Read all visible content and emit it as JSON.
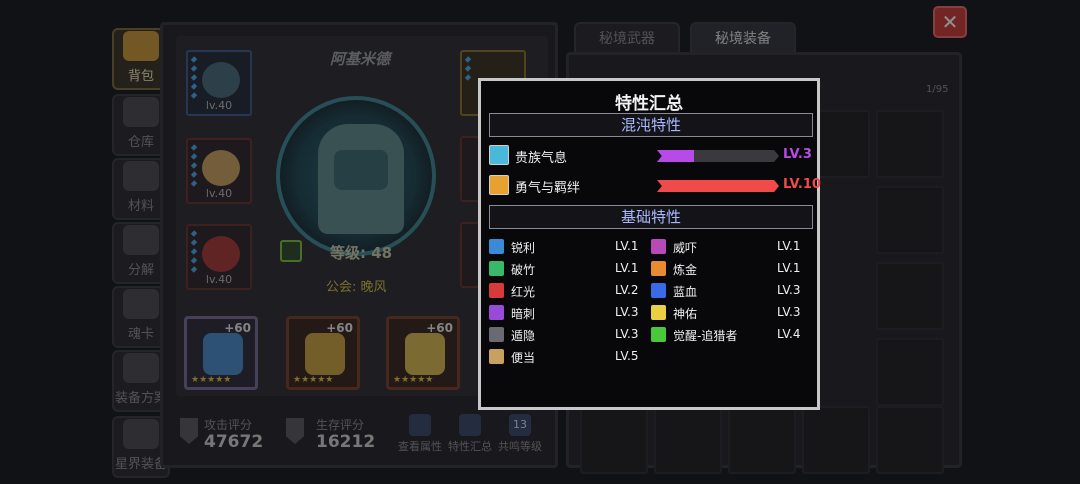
{
  "side_tabs": [
    {
      "label": "背包",
      "active": true
    },
    {
      "label": "仓库",
      "active": false
    },
    {
      "label": "材料",
      "active": false
    },
    {
      "label": "分解",
      "active": false
    },
    {
      "label": "魂卡",
      "active": false
    },
    {
      "label": "装备方案",
      "active": false
    },
    {
      "label": "星界装备",
      "active": false
    }
  ],
  "character": {
    "name": "阿基米德",
    "level_label": "等级: 48",
    "guild_label": "公会: 晚风",
    "equip_levels": [
      "lv.40",
      "lv.40",
      "lv.40",
      "lv.40"
    ],
    "upgrade_plus": [
      "+60",
      "+60",
      "+60"
    ],
    "stars": "★★★★★"
  },
  "stats": {
    "attack_label": "攻击评分",
    "attack_value": "47672",
    "survival_label": "生存评分",
    "survival_value": "16212"
  },
  "bottom_buttons": [
    {
      "label": "查看属性"
    },
    {
      "label": "特性汇总"
    },
    {
      "label": "共鸣等级",
      "badge": "13"
    }
  ],
  "right_tabs": [
    {
      "label": "秘境武器",
      "active": false
    },
    {
      "label": "秘境装备",
      "active": true
    }
  ],
  "inventory_count": "1/95",
  "close_label": "✕",
  "popup": {
    "title": "特性汇总",
    "chaos_header": "混沌特性",
    "chaos_traits": [
      {
        "name": "贵族气息",
        "level": "LV.3",
        "color": "#b84ae8",
        "fill": 0.3,
        "icon_color": "#4ab8d8"
      },
      {
        "name": "勇气与羁绊",
        "level": "LV.10",
        "color": "#f04a4a",
        "fill": 1.0,
        "icon_color": "#e8a030"
      }
    ],
    "basic_header": "基础特性",
    "basic_left": [
      {
        "name": "锐利",
        "level": "LV.1",
        "icon_color": "#3a8ad8"
      },
      {
        "name": "破竹",
        "level": "LV.1",
        "icon_color": "#3ab86a"
      },
      {
        "name": "红光",
        "level": "LV.2",
        "icon_color": "#d83a3a"
      },
      {
        "name": "暗刺",
        "level": "LV.3",
        "icon_color": "#9a4ad8"
      },
      {
        "name": "遁隐",
        "level": "LV.3",
        "icon_color": "#6a6a72"
      },
      {
        "name": "便当",
        "level": "LV.5",
        "icon_color": "#c8a060"
      }
    ],
    "basic_right": [
      {
        "name": "威吓",
        "level": "LV.1",
        "icon_color": "#b84ab8"
      },
      {
        "name": "炼金",
        "level": "LV.1",
        "icon_color": "#e88a30"
      },
      {
        "name": "蓝血",
        "level": "LV.3",
        "icon_color": "#3a6ae8"
      },
      {
        "name": "神佑",
        "level": "LV.3",
        "icon_color": "#e8d040"
      },
      {
        "name": "觉醒-追猎者",
        "level": "LV.4",
        "icon_color": "#4ac83a"
      }
    ]
  }
}
